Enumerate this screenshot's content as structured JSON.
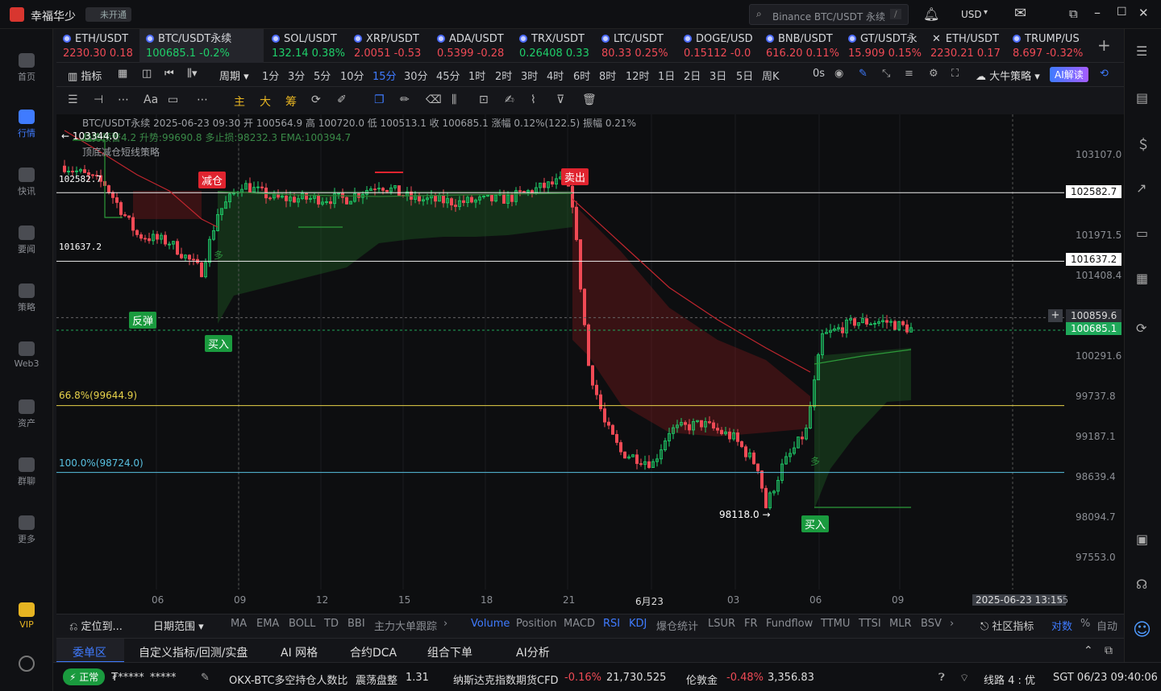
{
  "app": {
    "title": "幸福华少",
    "badge": "未开通",
    "search_placeholder": "Binance BTC/USDT 永续",
    "search_shortcut": "/",
    "currency": "USD"
  },
  "left_nav": [
    "首页",
    "行情",
    "快讯",
    "要闻",
    "策略",
    "Web3",
    "资产",
    "群聊",
    "更多",
    "VIP"
  ],
  "tickers": [
    {
      "name": "ETH/USDT",
      "price": "2230.30",
      "chg": "0.18",
      "up": false
    },
    {
      "name": "BTC/USDT永续",
      "price": "100685.1",
      "chg": "-0.2%",
      "up": true,
      "selected": true
    },
    {
      "name": "SOL/USDT",
      "price": "132.14",
      "chg": "0.38%",
      "up": true
    },
    {
      "name": "XRP/USDT",
      "price": "2.0051",
      "chg": "-0.53",
      "up": false
    },
    {
      "name": "ADA/USDT",
      "price": "0.5399",
      "chg": "-0.28",
      "up": false
    },
    {
      "name": "TRX/USDT",
      "price": "0.26408",
      "chg": "0.33",
      "up": true
    },
    {
      "name": "LTC/USDT",
      "price": "80.33",
      "chg": "0.25%",
      "up": false
    },
    {
      "name": "DOGE/USD",
      "price": "0.15112",
      "chg": "-0.0",
      "up": false
    },
    {
      "name": "BNB/USDT",
      "price": "616.20",
      "chg": "0.11%",
      "up": false
    },
    {
      "name": "GT/USDT永",
      "price": "15.909",
      "chg": "0.15%",
      "up": false
    },
    {
      "name": "ETH/USDT",
      "price": "2230.21",
      "chg": "0.17",
      "up": false
    },
    {
      "name": "TRUMP/US",
      "price": "8.697",
      "chg": "-0.32%",
      "up": false
    }
  ],
  "toolbar": {
    "indicator": "指标",
    "period": "周期",
    "intervals": [
      "1分",
      "3分",
      "5分",
      "10分",
      "15分",
      "30分",
      "45分",
      "1时",
      "2时",
      "3时",
      "4时",
      "6时",
      "8时",
      "12时",
      "1日",
      "2日",
      "3日",
      "5日",
      "周K"
    ],
    "selected_interval": "15分",
    "zero_s": "0s",
    "strategy": "大牛策略",
    "ai": "AI解读"
  },
  "draw_tools": {
    "font": "Aa",
    "main": "主",
    "big": "大",
    "chip": "筹"
  },
  "chart": {
    "header": "BTC/USDT永续 2025-06-23 09:30 开 100564.9 高 100720.0 低 100513.1 收 100685.1 涨幅 0.12%(122.5) 振幅 0.21%",
    "line2": "趋势预警4.2  升势:99690.8 多止损:98232.3 EMA:100394.7",
    "line3": "顶底减仓短线策略",
    "marker_high": "103344.0",
    "levels": [
      {
        "label": "102582.7",
        "tag": "102582.7"
      },
      {
        "label": "101637.2",
        "tag": "101637.2"
      },
      {
        "label": "66.8%(99644.9)"
      },
      {
        "label": "100.0%(98724.0)"
      }
    ],
    "low_marker": "98118.0",
    "price_axis": [
      "103107.0",
      "101971.5",
      "101408.4",
      "100859.6",
      "100291.6",
      "99737.8",
      "99187.1",
      "98639.4",
      "98094.7",
      "97553.0"
    ],
    "current_price": "100685.1",
    "hover_price": "100859.6",
    "signals": {
      "reduce": "减仓",
      "sell": "卖出",
      "rebound": "反弹",
      "buy": "买入",
      "long": "多"
    },
    "time_axis": [
      "06",
      "09",
      "12",
      "15",
      "18",
      "21",
      "6月23",
      "03",
      "06",
      "09"
    ],
    "time_cursor": "2025-06-23 13:15",
    "time_tail": "15"
  },
  "indicators": {
    "locate": "定位到...",
    "range": "日期范围",
    "list": [
      "MA",
      "EMA",
      "BOLL",
      "TD",
      "BBI",
      "主力大单跟踪",
      "Volume",
      "Position",
      "MACD",
      "RSI",
      "KDJ",
      "爆仓统计",
      "LSUR",
      "FR",
      "Fundflow",
      "TTMU",
      "TTSI",
      "MLR",
      "BSV"
    ],
    "community": "社区指标",
    "pair": "对数",
    "pct": "%",
    "auto": "自动"
  },
  "bottom_tabs": [
    "委单区",
    "自定义指标/回测/实盘",
    "AI 网格",
    "合约DCA",
    "组合下单",
    "AI分析"
  ],
  "status": {
    "state": "正常",
    "mask1": "₮*****",
    "mask2": "*****",
    "ratio_name": "OKX-BTC多空持仓人数比",
    "ratio_state": "震荡盘整",
    "ratio_val": "1.31",
    "nasdaq": "纳斯达克指数期货CFD",
    "nasdaq_chg": "-0.16%",
    "nasdaq_val": "21,730.525",
    "gold": "伦敦金",
    "gold_chg": "-0.48%",
    "gold_val": "3,356.83",
    "line": "线路 4 : 优",
    "time": "SGT 06/23 09:40:06"
  },
  "colors": {
    "up": "#1fcf6a",
    "down": "#ef4a55",
    "accent": "#3f7bff",
    "level_yellow": "#e8d24a",
    "level_cyan": "#58c0e0"
  }
}
